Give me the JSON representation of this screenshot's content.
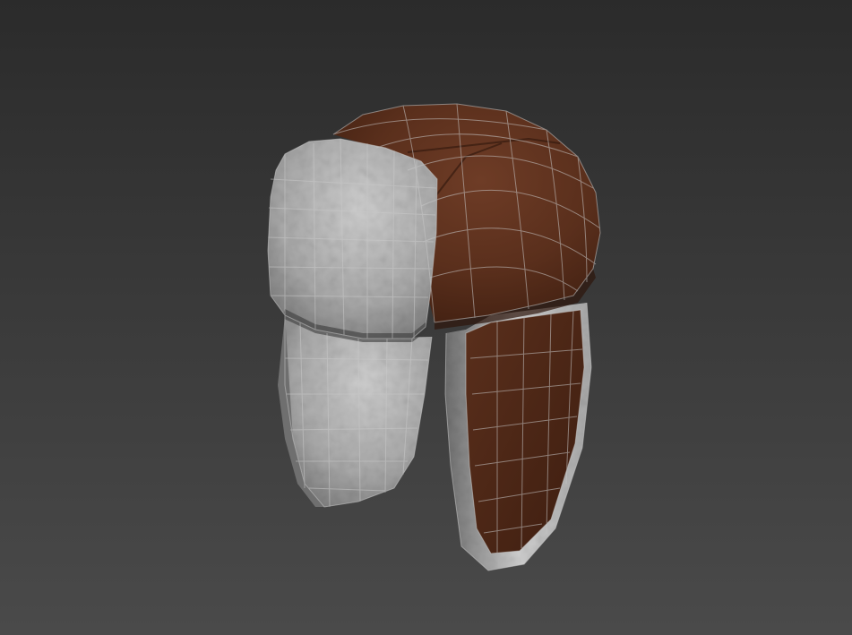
{
  "viewport": {
    "background_top": "#2b2b2b",
    "background_bottom": "#4a4a4a",
    "wireframe_color": "#c9c9c9",
    "wireframe_opacity": 0.55
  },
  "model": {
    "object": "trapper-hat",
    "leather_color": "#5a2f1c",
    "leather_highlight": "#6e3c26",
    "leather_shadow": "#3e1e10",
    "fur_color": "#a9a9a9",
    "fur_highlight": "#cfcfcf",
    "fur_shadow": "#6f6f6f"
  }
}
